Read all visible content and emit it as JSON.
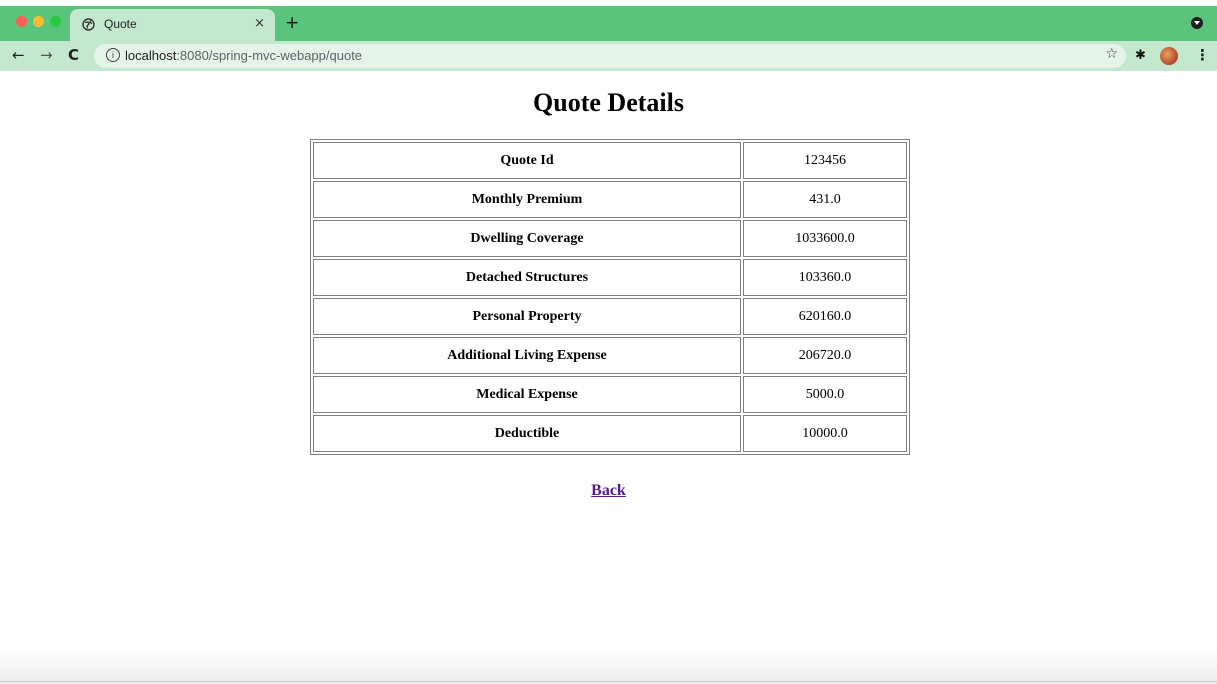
{
  "browser": {
    "tab": {
      "title": "Quote",
      "close_glyph": "×",
      "favicon": "globe-icon"
    },
    "new_tab_glyph": "+",
    "nav": {
      "back_glyph": "←",
      "forward_glyph": "→",
      "reload_glyph": "C"
    },
    "address_bar": {
      "info_glyph": "i",
      "url_host": "localhost",
      "url_rest": ":8080/spring-mvc-webapp/quote"
    },
    "star_glyph": "☆",
    "extension_glyph": "✱",
    "menu_glyph": "⋮",
    "colors": {
      "tabstrip": "#5ac47d",
      "toolbar": "#c3e8cd"
    }
  },
  "page": {
    "title": "Quote Details",
    "rows": [
      {
        "label": "Quote Id",
        "value": "123456"
      },
      {
        "label": "Monthly Premium",
        "value": "431.0"
      },
      {
        "label": "Dwelling Coverage",
        "value": "1033600.0"
      },
      {
        "label": "Detached Structures",
        "value": "103360.0"
      },
      {
        "label": "Personal Property",
        "value": "620160.0"
      },
      {
        "label": "Additional Living Expense",
        "value": "206720.0"
      },
      {
        "label": "Medical Expense",
        "value": "5000.0"
      },
      {
        "label": "Deductible",
        "value": "10000.0"
      }
    ],
    "back_link": "Back"
  }
}
